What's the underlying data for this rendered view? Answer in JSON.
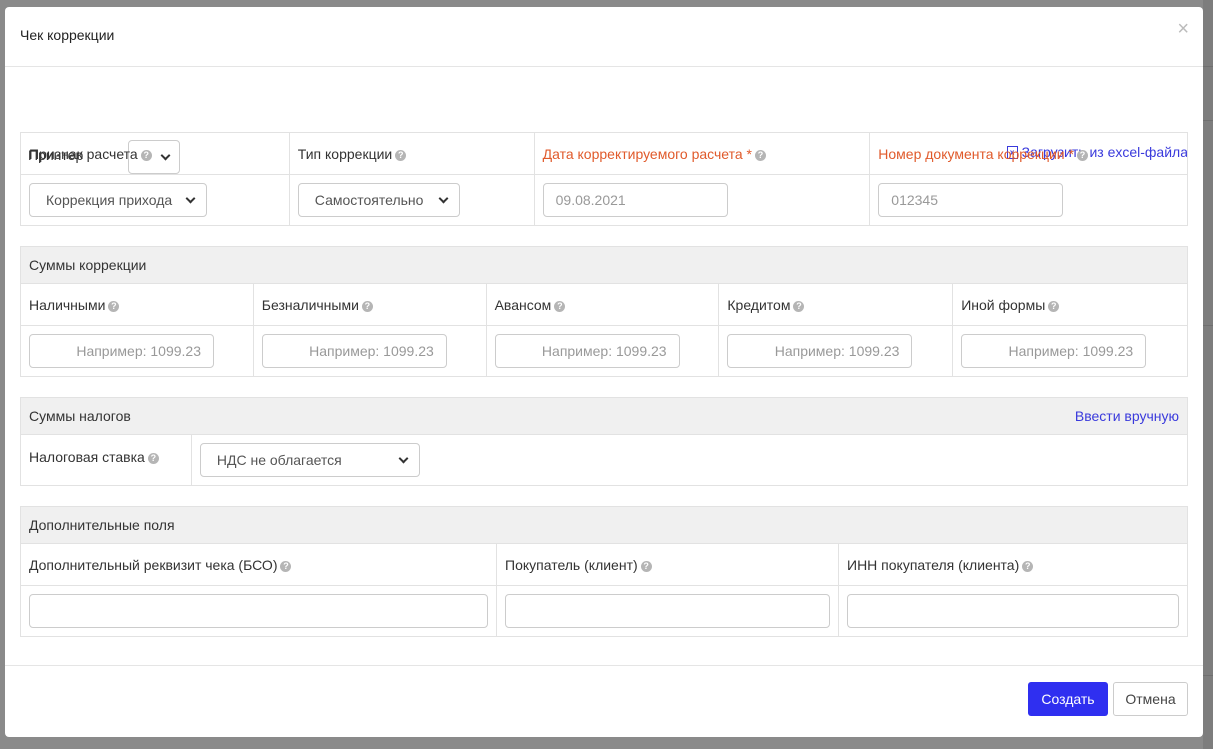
{
  "modal": {
    "title": "Чек коррекции",
    "close": "×"
  },
  "printer": {
    "label": "Принтер",
    "value": ""
  },
  "excel_link": "Загрузить из excel-файла",
  "main_table": {
    "headers": {
      "sign": "Признак расчета",
      "type": "Тип коррекции",
      "date": "Дата корректируемого расчета *",
      "doc_number": "Номер документа коррекции *"
    },
    "sign_value": "Коррекция прихода",
    "type_value": "Самостоятельно",
    "date_value": "09.08.2021",
    "doc_number_value": "012345"
  },
  "sums": {
    "title": "Суммы коррекции",
    "columns": [
      "Наличными",
      "Безналичными",
      "Авансом",
      "Кредитом",
      "Иной формы"
    ],
    "placeholder": "Например: 1099.23"
  },
  "taxes": {
    "title": "Суммы налогов",
    "manual_link": "Ввести вручную",
    "rate_label": "Налоговая ставка",
    "rate_value": "НДС не облагается"
  },
  "extra": {
    "title": "Дополнительные поля",
    "columns": [
      "Дополнительный реквизит чека (БСО)",
      "Покупатель (клиент)",
      "ИНН покупателя (клиента)"
    ]
  },
  "footer": {
    "create": "Создать",
    "cancel": "Отмена"
  },
  "colors": {
    "accent": "#2f2ff0",
    "required": "#e05a2b",
    "link": "#3a3adc"
  }
}
